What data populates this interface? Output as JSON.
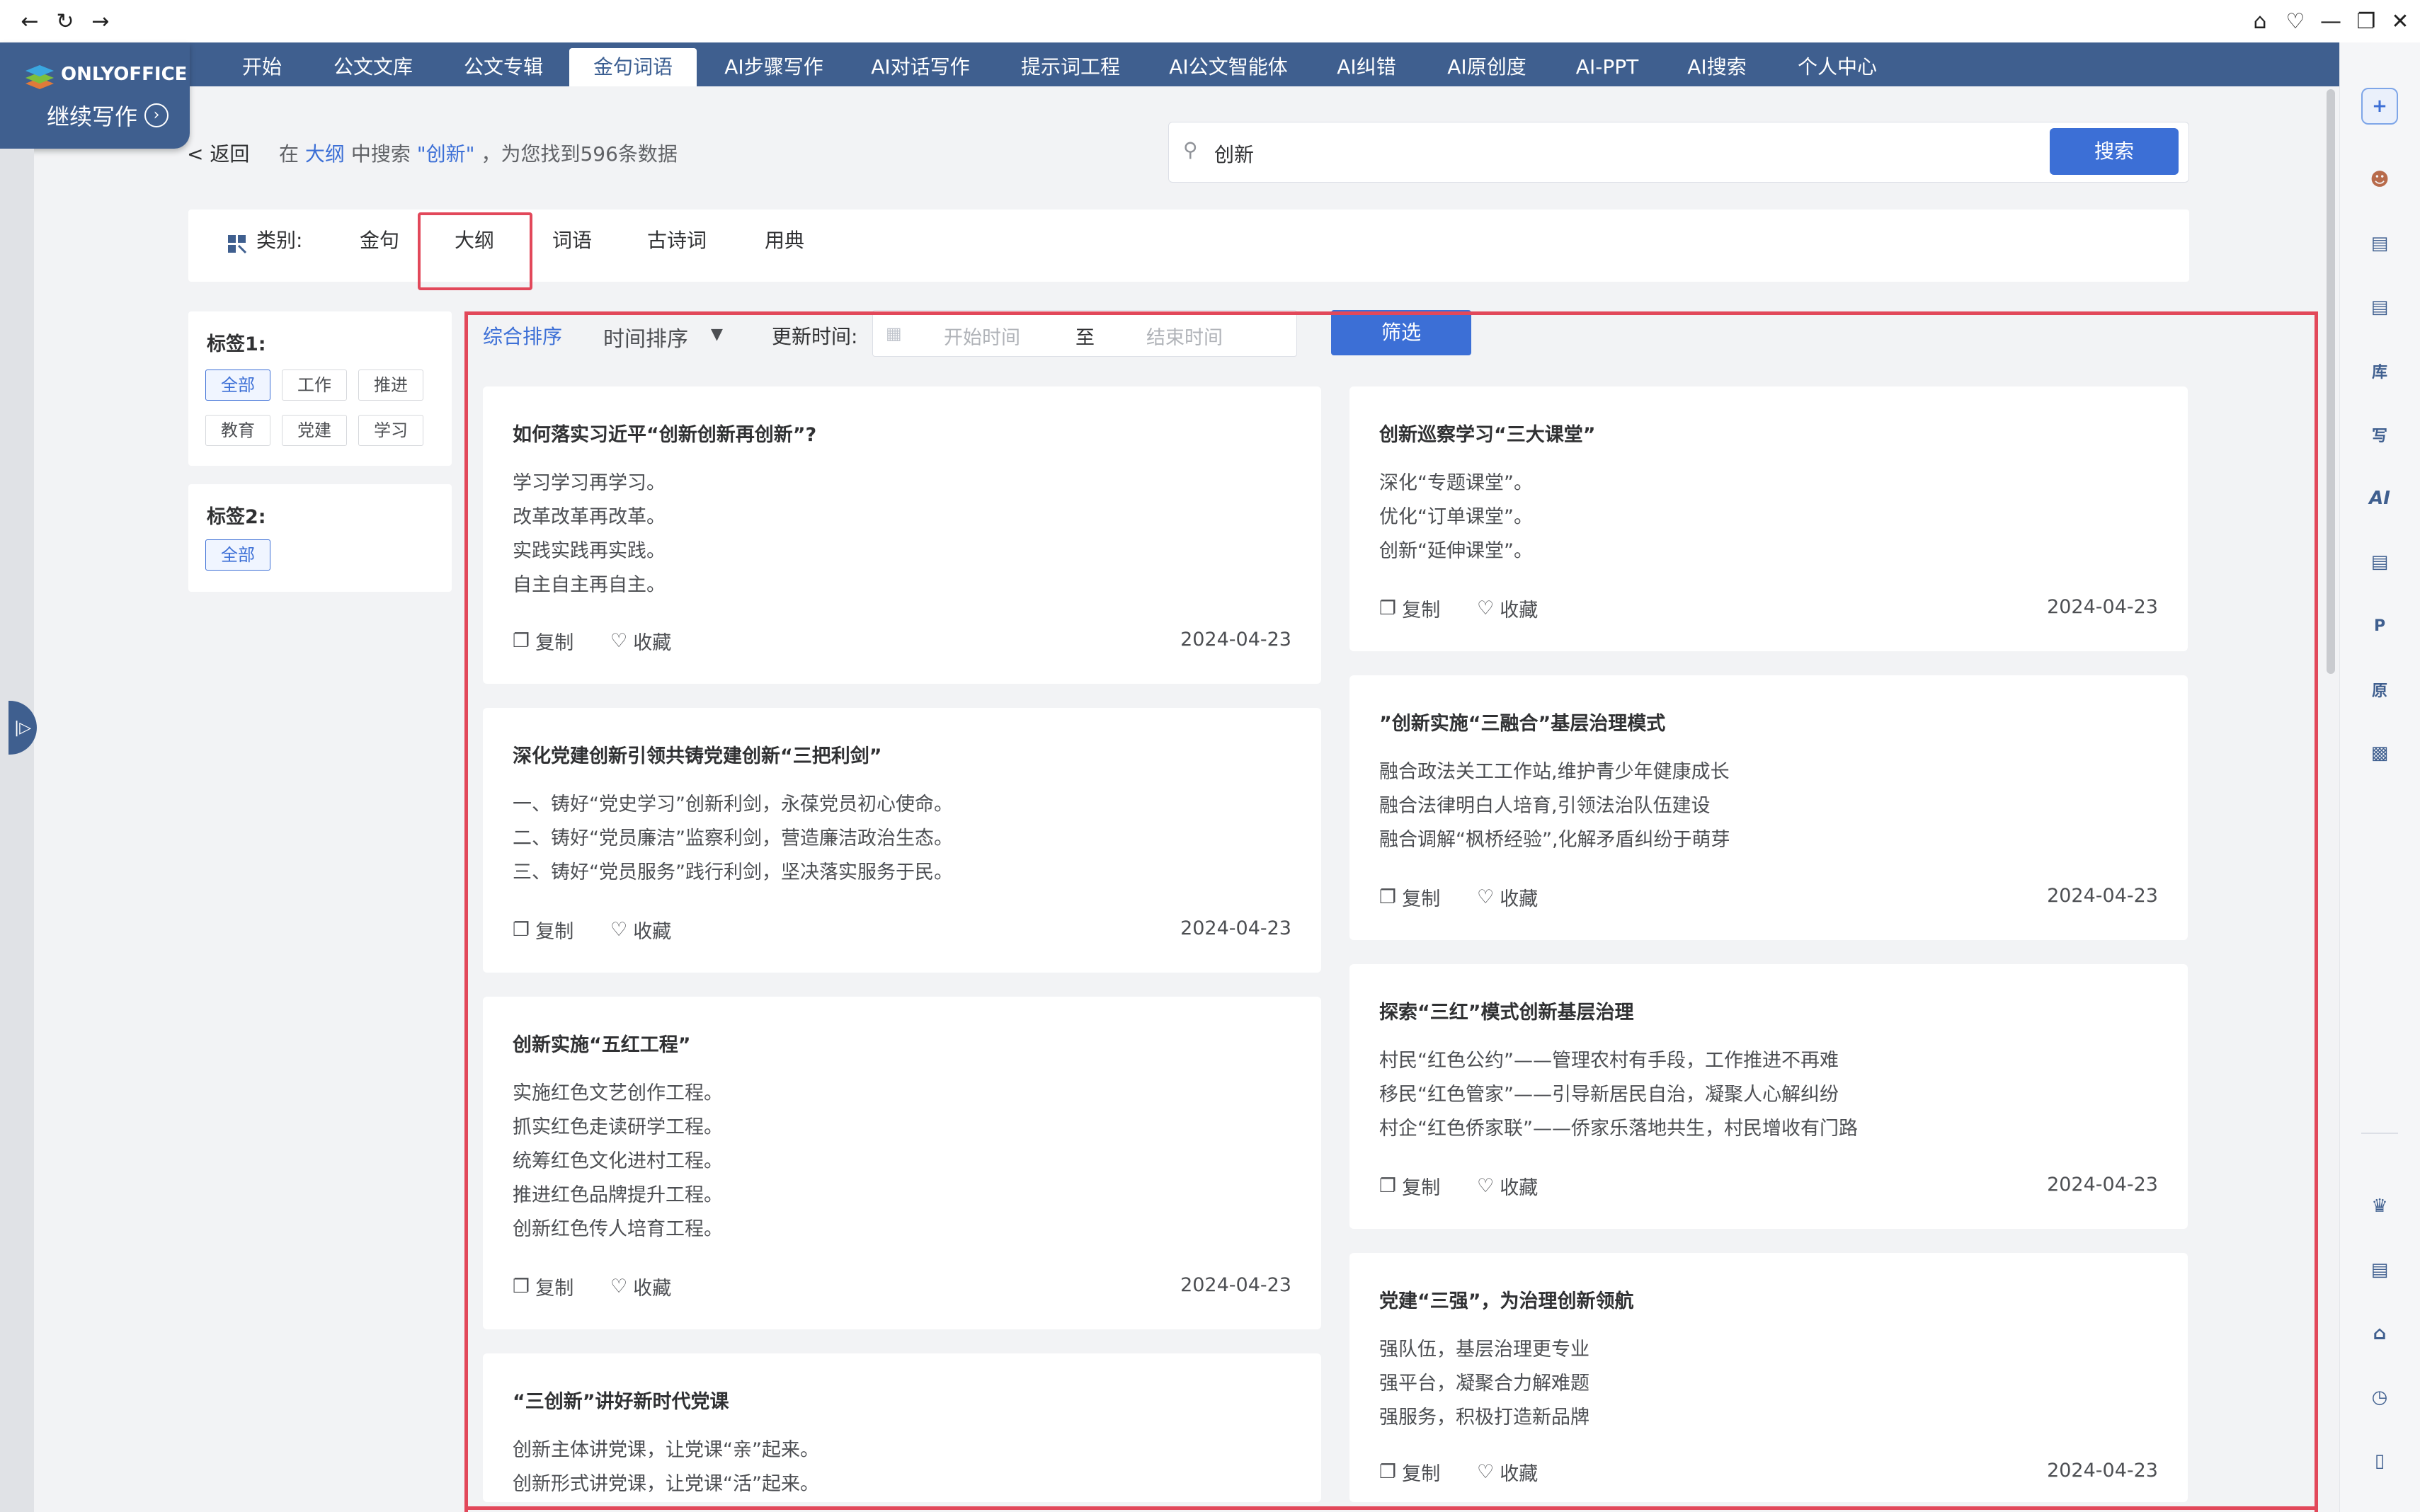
{
  "browser": {
    "back_icon": "arrow-left",
    "reload_icon": "refresh",
    "forward_icon": "arrow-right",
    "home_icon": "home",
    "window_icons": [
      "home",
      "pin",
      "minimize",
      "restore",
      "close"
    ]
  },
  "brand": {
    "logo_text": "ONLYOFFICE",
    "subtitle": "继续写作"
  },
  "nav": {
    "tabs": [
      {
        "label": "开始"
      },
      {
        "label": "公文文库"
      },
      {
        "label": "公文专辑"
      },
      {
        "label": "金句词语"
      },
      {
        "label": "AI步骤写作"
      },
      {
        "label": "AI对话写作"
      },
      {
        "label": "提示词工程"
      },
      {
        "label": "AI公文智能体"
      },
      {
        "label": "AI纠错"
      },
      {
        "label": "AI原创度"
      },
      {
        "label": "AI-PPT"
      },
      {
        "label": "AI搜索"
      },
      {
        "label": "个人中心"
      }
    ],
    "active_index": 3
  },
  "result": {
    "back_label": "< 返回",
    "prefix": "在",
    "scope": "大纲",
    "middle": "中搜索",
    "keyword": "\"创新\"",
    "suffix": "，为您找到596条数据"
  },
  "search": {
    "value": "创新",
    "button_label": "搜索"
  },
  "categories": {
    "label": "类别:",
    "items": [
      "金句",
      "大纲",
      "词语",
      "古诗词",
      "用典"
    ],
    "active_index": 1
  },
  "tags1": {
    "title": "标签1:",
    "items": [
      "全部",
      "工作",
      "推进",
      "教育",
      "党建",
      "学习"
    ],
    "active_index": 0
  },
  "tags2": {
    "title": "标签2:",
    "items": [
      "全部"
    ],
    "active_index": 0
  },
  "filters": {
    "sort_overall": "综合排序",
    "sort_time": "时间排序",
    "update_label": "更新时间:",
    "start_placeholder": "开始时间",
    "to_label": "至",
    "end_placeholder": "结束时间",
    "filter_button": "筛选"
  },
  "actions": {
    "copy": "复制",
    "favorite": "收藏"
  },
  "cards": {
    "left": [
      {
        "title": "如何落实习近平“创新创新再创新”?",
        "lines": [
          "学习学习再学习。",
          "改革改革再改革。",
          "实践实践再实践。",
          "自主自主再自主。"
        ],
        "date": "2024-04-23"
      },
      {
        "title": "深化党建创新引领共铸党建创新“三把利剑”",
        "lines": [
          "一、铸好“党史学习”创新利剑，永葆党员初心使命。",
          "二、铸好“党员廉洁”监察利剑，营造廉洁政治生态。",
          "三、铸好“党员服务”践行利剑，坚决落实服务于民。"
        ],
        "date": "2024-04-23"
      },
      {
        "title": "创新实施“五红工程”",
        "lines": [
          "实施红色文艺创作工程。",
          "抓实红色走读研学工程。",
          "统筹红色文化进村工程。",
          "推进红色品牌提升工程。",
          "创新红色传人培育工程。"
        ],
        "date": "2024-04-23"
      },
      {
        "title": "“三创新”讲好新时代党课",
        "lines": [
          "创新主体讲党课，让党课“亲”起来。",
          "创新形式讲党课，让党课“活”起来。"
        ],
        "date": ""
      }
    ],
    "right": [
      {
        "title": "创新巡察学习“三大课堂”",
        "lines": [
          "深化“专题课堂”。",
          "优化“订单课堂”。",
          "创新“延伸课堂”。"
        ],
        "date": "2024-04-23"
      },
      {
        "title": "”创新实施“三融合”基层治理模式",
        "lines": [
          "融合政法关工工作站,维护青少年健康成长",
          "融合法律明白人培育,引领法治队伍建设",
          "融合调解“枫桥经验”,化解矛盾纠纷于萌芽"
        ],
        "date": "2024-04-23"
      },
      {
        "title": "探索“三红”模式创新基层治理",
        "lines": [
          "村民“红色公约”——管理农村有手段，工作推进不再难",
          "移民“红色管家”——引导新居民自治，凝聚人心解纠纷",
          "村企“红色侨家联”——侨家乐落地共生，村民增收有门路"
        ],
        "date": "2024-04-23"
      },
      {
        "title": "党建“三强”，为治理创新领航",
        "lines": [
          "强队伍，基层治理更专业",
          "强平台，凝聚合力解难题",
          "强服务，积极打造新品牌"
        ],
        "date": "2024-04-23"
      }
    ]
  },
  "right_toolbar": {
    "icons": [
      "new-icon",
      "avatar-icon",
      "briefcase-icon",
      "document-icon",
      "library-icon",
      "write-icon",
      "ai-icon",
      "notebook-icon",
      "p-icon",
      "original-icon",
      "gift-icon",
      "crown-icon",
      "chart-icon",
      "home-icon",
      "clock-icon",
      "phone-icon"
    ],
    "labels": {
      "library": "库",
      "write": "写",
      "ai": "AI",
      "p": "P",
      "original": "原"
    }
  },
  "colors": {
    "nav_bg": "#3f5f8f",
    "accent": "#3c6fd6",
    "highlight_border": "#e2485a",
    "page_bg": "#f2f3f5"
  }
}
